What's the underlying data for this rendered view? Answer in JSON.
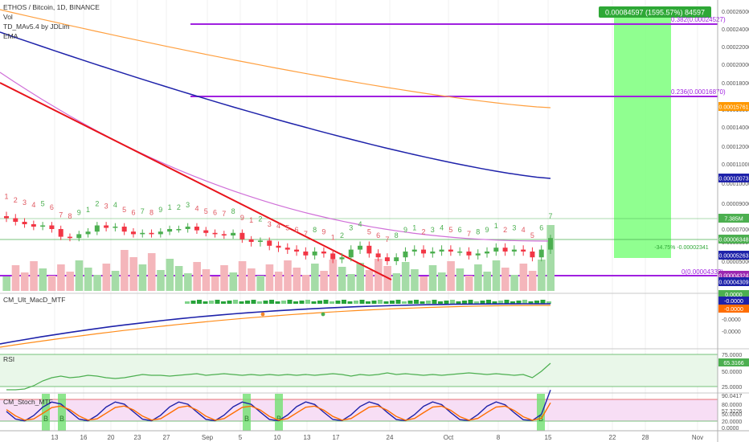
{
  "header": {
    "symbol": "ETHOS / Bitcoin, 1D, BINANCE",
    "indicators": [
      "Vol",
      "TD_MAv5.4 by JDLim",
      "EMA"
    ]
  },
  "price_axis": {
    "ticks": [
      "0.00026000",
      "0.00024000",
      "0.00022000",
      "0.00020000",
      "0.00018000",
      "0.00016000",
      "0.00014000",
      "0.00012000",
      "0.00011000",
      "0.00010000",
      "0.00009000",
      "0.00008000",
      "0.00007000",
      "0.00006000",
      "0.00005000",
      "0.00004000"
    ],
    "badges": [
      {
        "text": "0.00015761",
        "color": "#ff9800"
      },
      {
        "text": "0.00010073",
        "color": "#1e22aa"
      },
      {
        "text": "7.385M",
        "color": "#4caf50"
      },
      {
        "text": "0.00006348",
        "color": "#4caf50"
      },
      {
        "text": "0.00005263",
        "color": "#1e22aa"
      },
      {
        "text": "0.00004324",
        "color": "#9c27b0"
      },
      {
        "text": "0.00004309",
        "color": "#1e22aa"
      }
    ]
  },
  "fib_levels": [
    {
      "label": "0.382(0.00024527)"
    },
    {
      "label": "0.236(0.00016870)"
    },
    {
      "label": "0(0.00004332)"
    }
  ],
  "measure": {
    "badge": "0.00084597 (1595.57%) 84597",
    "down_label": "-34.75% -0.00002341"
  },
  "macd_panel": {
    "title": "CM_Ult_MacD_MTF",
    "ticks": [
      "0.0000",
      "-0.0000",
      "-0.0000",
      "-0.0000",
      "-0.0000"
    ],
    "badges": [
      {
        "text": "0.0000",
        "color": "#4caf50"
      },
      {
        "text": "-0.0000",
        "color": "#1e22aa"
      },
      {
        "text": "-0.0000",
        "color": "#ff6d00"
      }
    ]
  },
  "rsi_panel": {
    "title": "RSI",
    "ticks": [
      "75.0000",
      "65.3166",
      "50.0000",
      "25.0000"
    ],
    "badge": "65.3166"
  },
  "stoch_panel": {
    "title": "CM_Stoch_MTF",
    "ticks": [
      "90.0417",
      "80.0000",
      "57.3226",
      "50.0000",
      "20.0000",
      "0.0000"
    ],
    "b_marker": "B"
  },
  "time_axis": {
    "labels": [
      "13",
      "16",
      "20",
      "23",
      "27",
      "Sep",
      "5",
      "10",
      "13",
      "17",
      "24",
      "Oct",
      "8",
      "15",
      "22",
      "28",
      "Nov"
    ]
  },
  "colors": {
    "up": "#26a69a",
    "up_candle": "#4caf50",
    "down": "#f23645",
    "ema_orange": "#ffa040",
    "ema_blue": "#1e22aa",
    "ema_pink": "#d070d8",
    "trend_red": "#e8141c",
    "fib": "#a020e0",
    "green_zone": "#70ff70"
  },
  "chart_data": {
    "type": "candlestick",
    "title": "ETHOS / Bitcoin, 1D, BINANCE",
    "close_series": [
      7.9e-05,
      7.6e-05,
      7.4e-05,
      7.2e-05,
      7.3e-05,
      7e-05,
      6.4e-05,
      6.3e-05,
      6.6e-05,
      6.8e-05,
      7.3e-05,
      7.1e-05,
      7.2e-05,
      6.8e-05,
      6.6e-05,
      6.7e-05,
      6.6e-05,
      6.8e-05,
      7e-05,
      7e-05,
      7.2e-05,
      6.9e-05,
      6.7e-05,
      6.6e-05,
      6.5e-05,
      6.7e-05,
      6.2e-05,
      6e-05,
      6.1e-05,
      5.8e-05,
      5.7e-05,
      5.6e-05,
      5.5e-05,
      5.3e-05,
      5.5e-05,
      5.4e-05,
      5.1e-05,
      5.2e-05,
      5.6e-05,
      5.8e-05,
      5.4e-05,
      5.2e-05,
      5e-05,
      5.2e-05,
      5.5e-05,
      5.6e-05,
      5.4e-05,
      5.5e-05,
      5.6e-05,
      5.5e-05,
      5.5e-05,
      5.3e-05,
      5.4e-05,
      5.5e-05,
      5.7e-05,
      5.5e-05,
      5.6e-05,
      5.5e-05,
      5.2e-05,
      5.6e-05,
      6.3e-05
    ],
    "price_range": [
      4e-05,
      0.00026
    ]
  }
}
